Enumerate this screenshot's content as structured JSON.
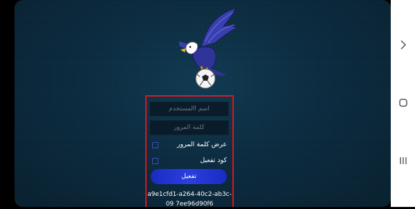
{
  "form": {
    "username_placeholder": "اسم االمستخدم",
    "password_placeholder": "كلمة المرور",
    "show_password_label": "عرض كلمة المرور",
    "activation_code_label": "كود تفعيل",
    "activate_button": "تفعيل",
    "device_code": "a9e1cfd1-a264-40c2-ab3c-09 7ee96d90f6"
  },
  "icons": {
    "logo": "eagle-football-logo",
    "back": "chevron-right-icon",
    "home": "home-rounded-rect-icon",
    "recents": "recent-apps-icon"
  },
  "colors": {
    "background": "#0b2b40",
    "highlight_border": "#e0141e",
    "button": "#2b3fe0",
    "checkbox_border": "#3a4fc0",
    "field_bg": "#0a1c2a"
  }
}
